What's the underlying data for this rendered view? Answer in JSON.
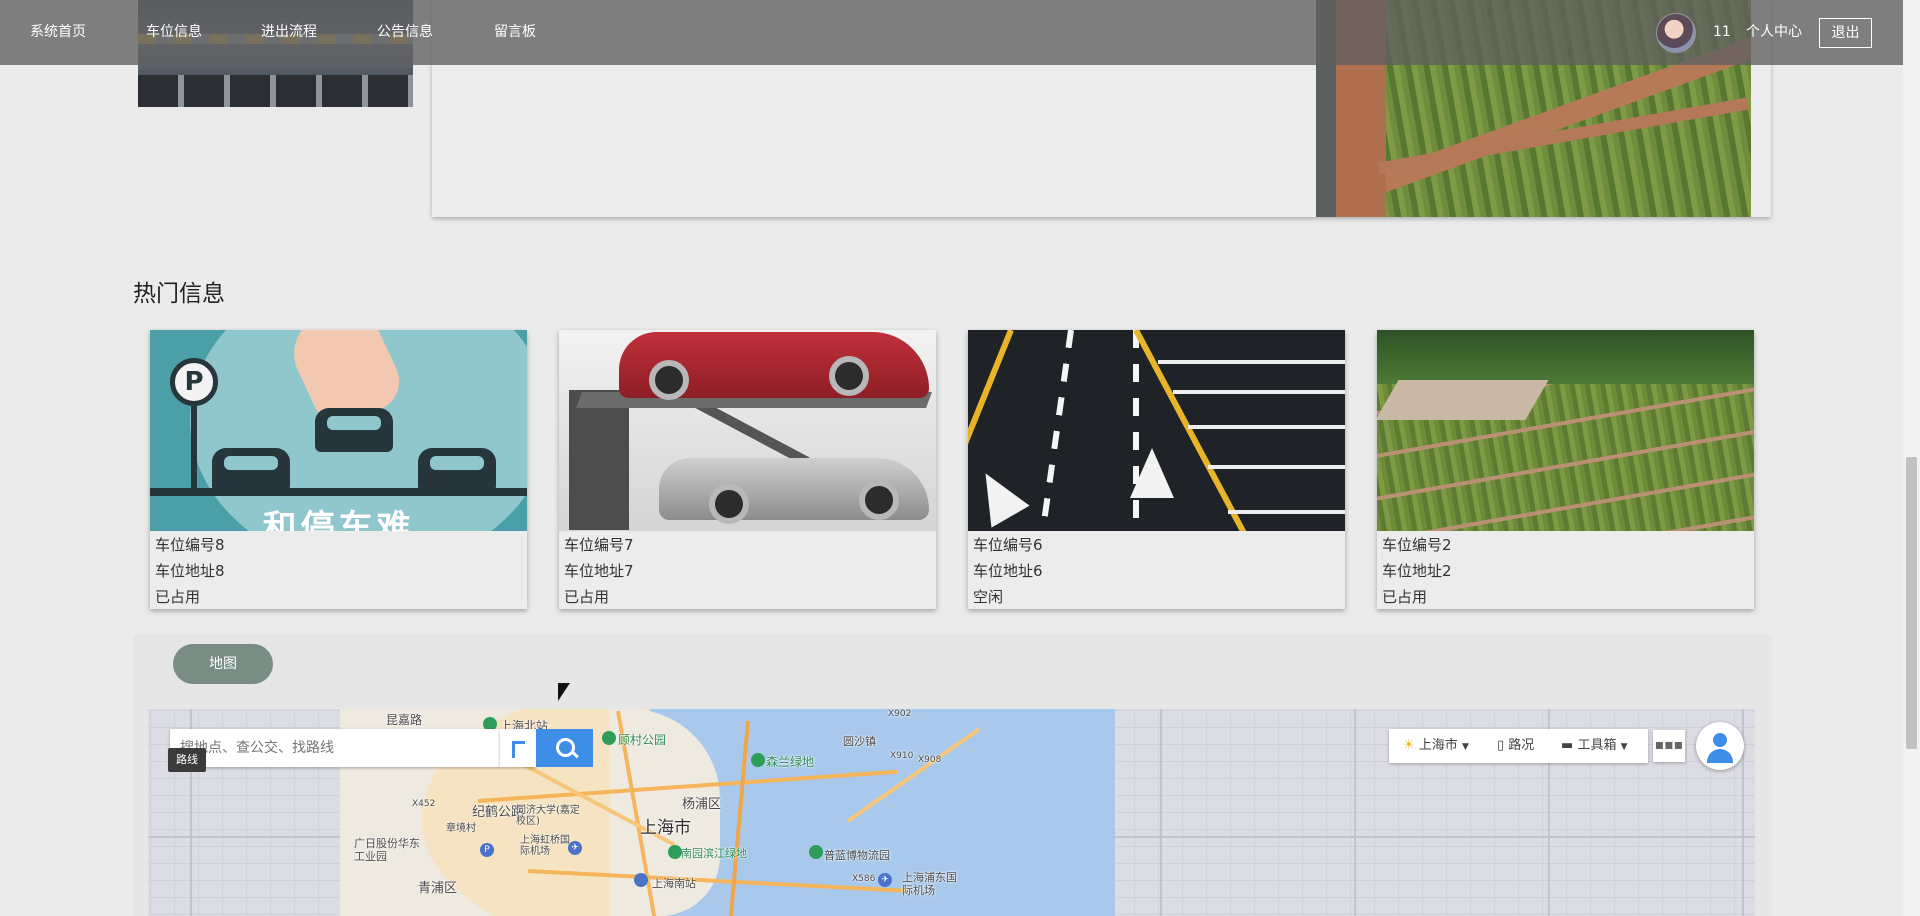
{
  "navbar": {
    "items": [
      {
        "label": "系统首页"
      },
      {
        "label": "车位信息"
      },
      {
        "label": "进出流程"
      },
      {
        "label": "公告信息"
      },
      {
        "label": "留言板"
      }
    ],
    "username": "11",
    "profile_label": "个人中心",
    "logout_label": "退出"
  },
  "hot": {
    "title": "热门信息",
    "cards": [
      {
        "code": "车位编号8",
        "address": "车位地址8",
        "status": "已占用",
        "image": "parking-illustration",
        "image_text": "和停车难"
      },
      {
        "code": "车位编号7",
        "address": "车位地址7",
        "status": "已占用",
        "image": "car-lift"
      },
      {
        "code": "车位编号6",
        "address": "车位地址6",
        "status": "空闲",
        "image": "road-markings"
      },
      {
        "code": "车位编号2",
        "address": "车位地址2",
        "status": "已占用",
        "image": "grass-parking"
      }
    ]
  },
  "map_section": {
    "tab_label": "地图",
    "search_placeholder": "搜地点、查公交、找路线",
    "route_tooltip": "路线",
    "toolbar": {
      "city": "上海市",
      "traffic": "路况",
      "toolbox": "工具箱"
    },
    "labels": [
      {
        "text": "昆嘉路",
        "kind": "road"
      },
      {
        "text": "上海北站",
        "kind": "poi"
      },
      {
        "text": "顾村公园",
        "kind": "green"
      },
      {
        "text": "X902",
        "kind": "road"
      },
      {
        "text": "圆沙镇",
        "kind": "town"
      },
      {
        "text": "X910",
        "kind": "road"
      },
      {
        "text": "X908",
        "kind": "road"
      },
      {
        "text": "森兰绿地",
        "kind": "green"
      },
      {
        "text": "杨浦区",
        "kind": "district"
      },
      {
        "text": "X452",
        "kind": "road"
      },
      {
        "text": "纪鹤公路",
        "kind": "road"
      },
      {
        "text": "上海市",
        "kind": "city"
      },
      {
        "text": "章境村",
        "kind": "town"
      },
      {
        "text": "同济大学(嘉定校区)",
        "kind": "poi"
      },
      {
        "text": "上海虹桥国际机场",
        "kind": "poi"
      },
      {
        "text": "南园滨江绿地",
        "kind": "green"
      },
      {
        "text": "普蓝博物流园",
        "kind": "poi"
      },
      {
        "text": "广日股份华东工业园",
        "kind": "poi"
      },
      {
        "text": "上海浦东国际机场",
        "kind": "poi"
      },
      {
        "text": "青浦区",
        "kind": "district"
      },
      {
        "text": "上海南站",
        "kind": "poi"
      },
      {
        "text": "X586",
        "kind": "road"
      }
    ]
  },
  "colors": {
    "navbar_bg": "#5f5f5f",
    "map_tab": "#7a8d84",
    "search_button": "#3e8ee8"
  }
}
